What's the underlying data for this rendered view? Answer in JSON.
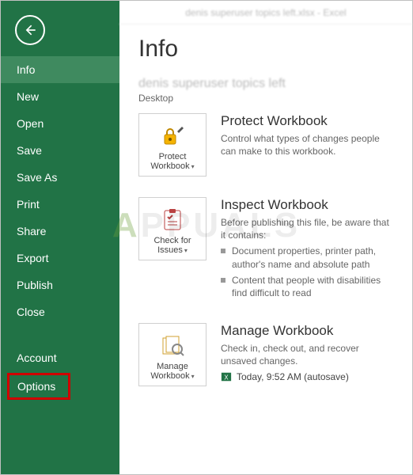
{
  "titlebar": "denis superuser topics left.xlsx - Excel",
  "sidebar": {
    "items": [
      {
        "label": "Info"
      },
      {
        "label": "New"
      },
      {
        "label": "Open"
      },
      {
        "label": "Save"
      },
      {
        "label": "Save As"
      },
      {
        "label": "Print"
      },
      {
        "label": "Share"
      },
      {
        "label": "Export"
      },
      {
        "label": "Publish"
      },
      {
        "label": "Close"
      }
    ],
    "account": "Account",
    "options": "Options"
  },
  "page": {
    "title": "Info",
    "doc_name": "denis superuser topics left",
    "doc_location": "Desktop"
  },
  "protect": {
    "tile_line1": "Protect",
    "tile_line2": "Workbook",
    "title": "Protect Workbook",
    "desc": "Control what types of changes people can make to this workbook."
  },
  "inspect": {
    "tile_line1": "Check for",
    "tile_line2": "Issues",
    "title": "Inspect Workbook",
    "desc": "Before publishing this file, be aware that it contains:",
    "bullets": [
      "Document properties, printer path, author's name and absolute path",
      "Content that people with disabilities find difficult to read"
    ]
  },
  "manage": {
    "tile_line1": "Manage",
    "tile_line2": "Workbook",
    "title": "Manage Workbook",
    "desc": "Check in, check out, and recover unsaved changes.",
    "autosave": "Today, 9:52 AM (autosave)"
  },
  "watermark": {
    "a": "A",
    "rest": "PPUALS"
  }
}
